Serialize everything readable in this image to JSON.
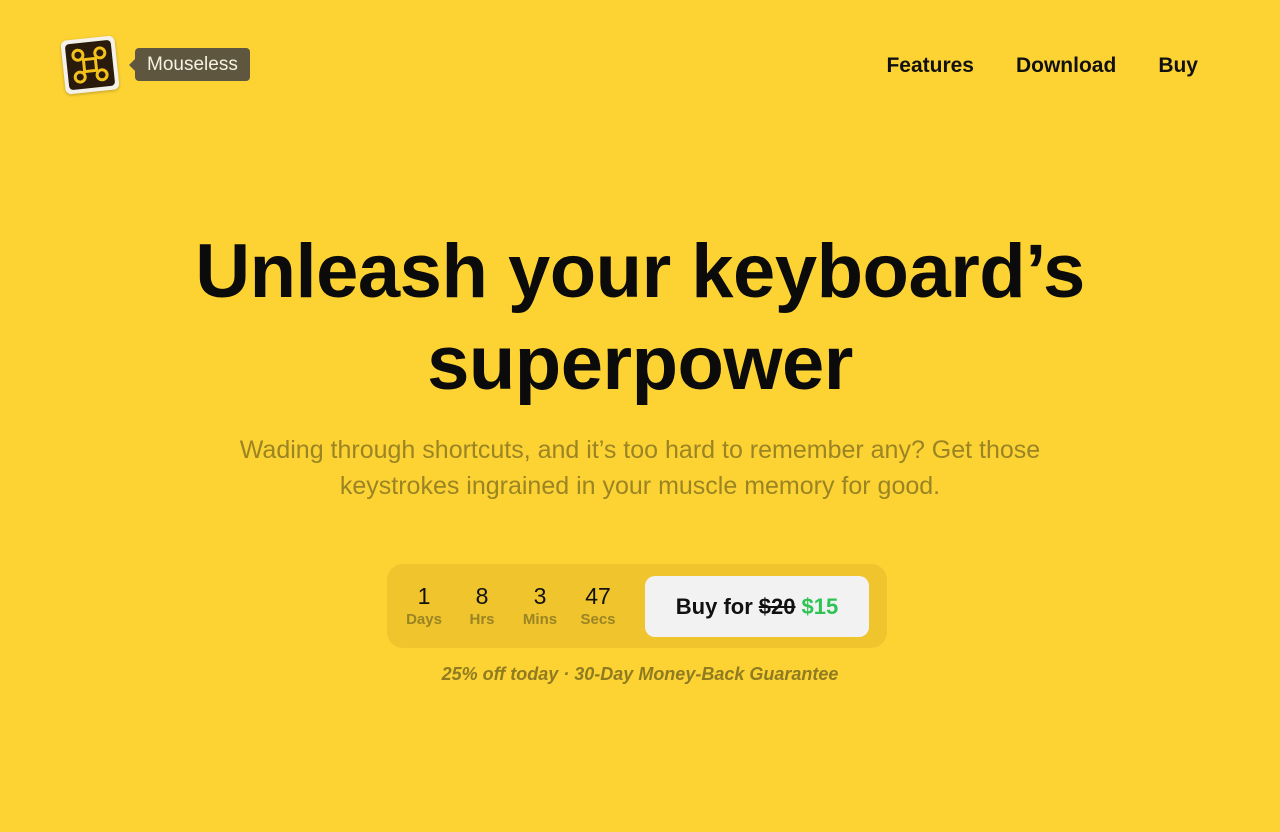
{
  "header": {
    "brand_name": "Mouseless",
    "logo_icon": "command-key-icon",
    "nav": [
      {
        "label": "Features"
      },
      {
        "label": "Download"
      },
      {
        "label": "Buy"
      }
    ]
  },
  "hero": {
    "title_line1": "Unleash your keyboard’s",
    "title_line2": "superpower",
    "subtitle": "Wading through shortcuts, and it’s too hard to remember any? Get those keystrokes ingrained in your muscle memory for good."
  },
  "countdown": [
    {
      "value": "1",
      "label": "Days"
    },
    {
      "value": "8",
      "label": "Hrs"
    },
    {
      "value": "3",
      "label": "Mins"
    },
    {
      "value": "47",
      "label": "Secs"
    }
  ],
  "buy_button": {
    "prefix": "Buy for",
    "old_price": "$20",
    "new_price": "$15"
  },
  "guarantee": "25% off today · 30-Day Money-Back Guarantee",
  "colors": {
    "background": "#FDD334",
    "new_price": "#2fc255",
    "cta_panel": "#EFC42C"
  }
}
